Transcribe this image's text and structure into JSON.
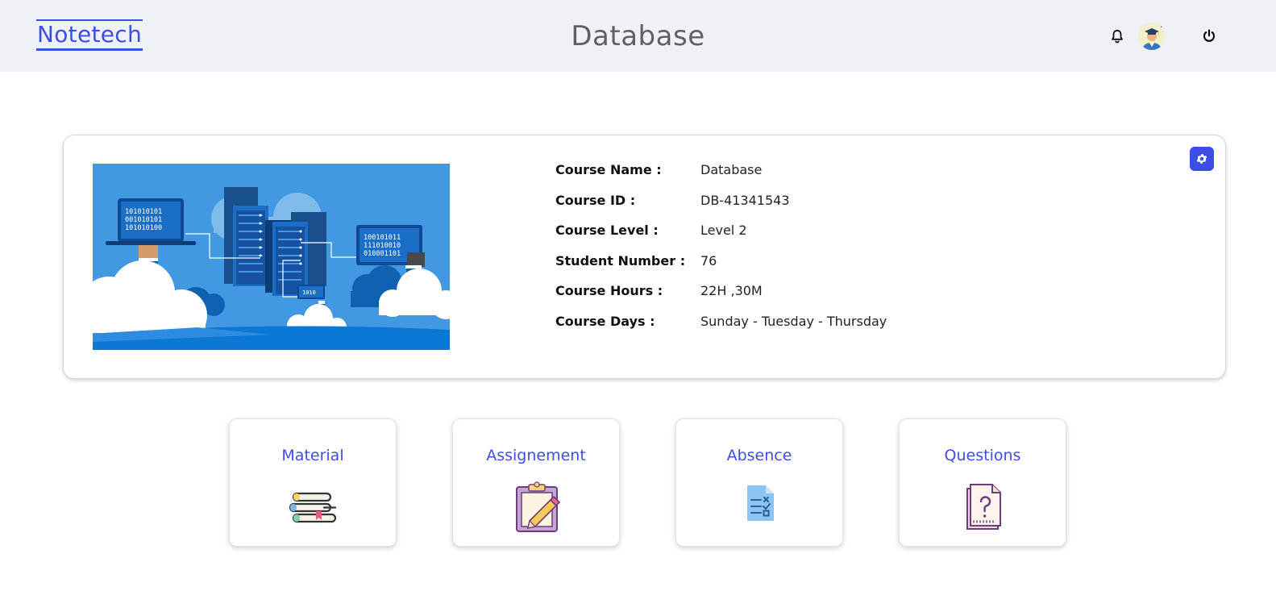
{
  "header": {
    "brand": "Notetech",
    "title": "Database",
    "icons": {
      "bell": "bell-icon",
      "avatar": "user-avatar",
      "power": "power-icon"
    }
  },
  "course": {
    "image_icon": "database-cloud-illustration",
    "image_texts": [
      "101010101",
      "001010101",
      "101010100",
      "100101011",
      "111010010",
      "010001101",
      "1010"
    ],
    "settings_icon": "gear-icon",
    "fields": [
      {
        "label": "Course Name :",
        "value": "Database"
      },
      {
        "label": "Course ID :",
        "value": "DB-41341543"
      },
      {
        "label": "Course Level :",
        "value": "Level 2"
      },
      {
        "label": "Student Number :",
        "value": "76"
      },
      {
        "label": "Course Hours :",
        "value": "22H ,30M"
      },
      {
        "label": "Course Days :",
        "value": "Sunday - Tuesday - Thursday"
      }
    ]
  },
  "tiles": [
    {
      "label": "Material",
      "icon": "books-icon"
    },
    {
      "label": "Assignement",
      "icon": "clipboard-pencil-icon"
    },
    {
      "label": "Absence",
      "icon": "checklist-document-icon"
    },
    {
      "label": "Questions",
      "icon": "question-document-icon"
    }
  ],
  "colors": {
    "accent": "#3d4de8",
    "header_bg": "#eef1f5",
    "image_bg": "#4299e1"
  }
}
